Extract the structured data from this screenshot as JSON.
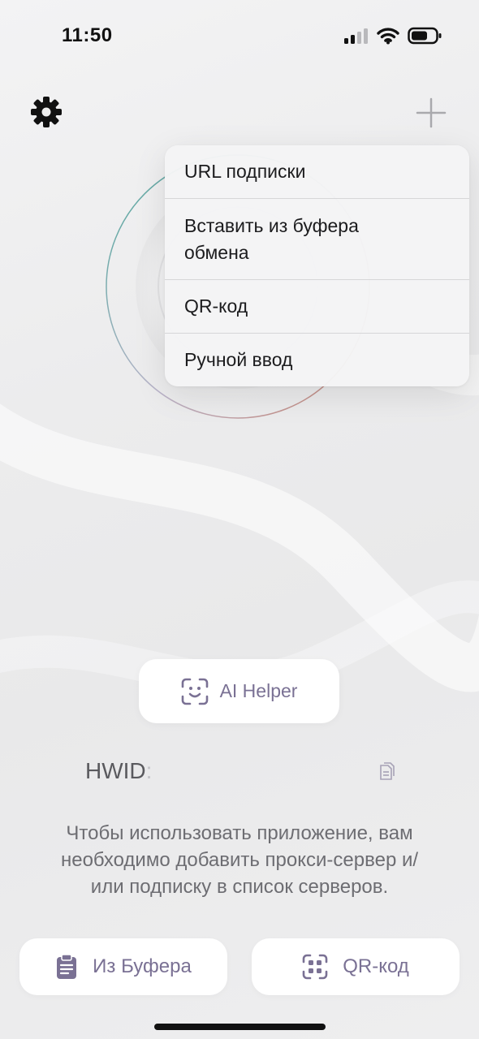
{
  "status_bar": {
    "time": "11:50"
  },
  "header": {
    "settings_icon": "gear-icon",
    "add_icon": "plus-icon"
  },
  "menu": {
    "items": [
      {
        "label": "URL подписки"
      },
      {
        "label": "Вставить из буфера обмена"
      },
      {
        "label": "QR-код"
      },
      {
        "label": "Ручной ввод"
      }
    ]
  },
  "ai_helper": {
    "label": "AI Helper",
    "icon": "face-scan-icon"
  },
  "hwid": {
    "label": "HWID",
    "separator": ":",
    "copy_icon": "copy-icon"
  },
  "info": {
    "text": "Чтобы использовать приложение, вам необходимо добавить прокси-сервер и/или подписку в список серверов."
  },
  "buttons": {
    "from_clipboard": {
      "label": "Из Буфера",
      "icon": "clipboard-icon"
    },
    "qr_code": {
      "label": "QR-код",
      "icon": "qr-scan-icon"
    }
  },
  "colors": {
    "accent": "#7a7194",
    "background": "#ececed",
    "menu_bg": "#f4f4f5"
  }
}
